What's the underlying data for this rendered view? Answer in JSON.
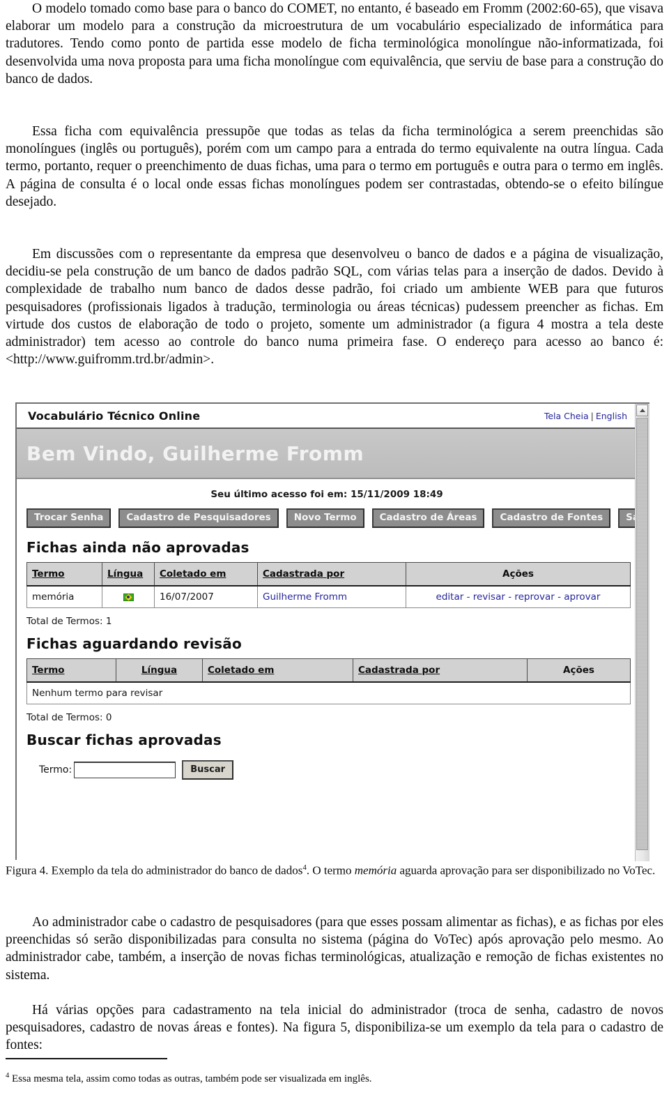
{
  "document": {
    "paragraphs": [
      "O modelo tomado como base para o banco do COMET, no entanto, é baseado em Fromm (2002:60-65), que visava elaborar um modelo para a construção da microestrutura de um vocabulário especializado de informática para tradutores. Tendo como ponto de partida esse modelo de ficha terminológica monolíngue não-informatizada, foi desenvolvida uma nova proposta para uma ficha monolíngue com equivalência, que serviu de base para a construção do banco de dados.",
      "Essa ficha com equivalência pressupõe que todas as telas da ficha terminológica a serem preenchidas são monolíngues (inglês ou português), porém com um campo para a entrada do termo equivalente na outra língua. Cada termo, portanto, requer o preenchimento de duas fichas, uma para o termo em português e outra para o termo em inglês. A página de consulta é o local onde essas fichas monolíngues podem ser contrastadas, obtendo-se o efeito bilíngue desejado.",
      "Em discussões com o representante da empresa que desenvolveu o banco de dados e a página de visualização, decidiu-se pela construção de um banco de dados padrão SQL, com várias telas para a inserção de dados. Devido à complexidade de trabalho num banco de dados desse padrão, foi criado um ambiente WEB para que futuros pesquisadores (profissionais ligados à tradução, terminologia ou áreas técnicas) pudessem preencher as fichas. Em virtude dos custos de elaboração de todo o projeto, somente um administrador (a figura 4 mostra a tela deste administrador) tem acesso ao controle do banco numa primeira fase. O endereço para acesso ao banco é: <http://www.guifromm.trd.br/admin>."
    ],
    "caption": {
      "prefix": "Figura 4. Exemplo da tela do administrador do banco de dados",
      "footnote_marker": "4",
      "middle": ". O termo ",
      "italic_term": "memória",
      "suffix": " aguarda aprovação para ser disponibilizado no VoTec."
    },
    "tail_paragraphs": [
      "Ao administrador cabe o cadastro de pesquisadores (para que esses possam alimentar as fichas), e as fichas por eles preenchidas só serão disponibilizadas para consulta no sistema (página do VoTec) após aprovação pelo mesmo. Ao administrador cabe, também, a inserção de novas fichas terminológicas, atualização e remoção de fichas existentes no sistema.",
      "Há várias opções para cadastramento na tela inicial do administrador (troca de senha, cadastro de novos pesquisadores, cadastro de novas áreas e fontes). Na figura 5, disponibiliza-se um exemplo da tela para o cadastro de fontes:"
    ],
    "footnote": {
      "marker": "4",
      "text": " Essa mesma tela, assim como todas as outras, também pode ser visualizada em inglês."
    }
  },
  "figure": {
    "app": {
      "title": "Vocabulário Técnico Online",
      "links": {
        "fullscreen": "Tela Cheia",
        "separator": "|",
        "english": "English"
      },
      "welcome": "Bem Vindo, Guilherme Fromm",
      "last_access": "Seu último acesso foi em: 15/11/2009 18:49",
      "buttons": [
        "Trocar Senha",
        "Cadastro de Pesquisadores",
        "Novo Termo",
        "Cadastro de Áreas",
        "Cadastro de Fontes",
        "Sair"
      ],
      "section_pending": {
        "heading": "Fichas ainda não aprovadas",
        "columns": [
          "Termo",
          "Língua",
          "Coletado em",
          "Cadastrada por",
          "Ações"
        ],
        "rows": [
          {
            "termo": "memória",
            "lingua_icon": "brazil-flag-icon",
            "coletado_em": "16/07/2007",
            "cadastrada_por": "Guilherme Fromm",
            "acoes": [
              "editar",
              "revisar",
              "reprovar",
              "aprovar"
            ],
            "acoes_text": "editar - revisar - reprovar - aprovar"
          }
        ],
        "total": "Total de Termos: 1"
      },
      "section_review": {
        "heading": "Fichas aguardando revisão",
        "columns": [
          "Termo",
          "Língua",
          "Coletado em",
          "Cadastrada por",
          "Ações"
        ],
        "empty_message": "Nenhum termo para revisar",
        "total": "Total de Termos: 0"
      },
      "section_search": {
        "heading": "Buscar fichas aprovadas",
        "label": "Termo:",
        "input_value": "",
        "input_placeholder": "",
        "button": "Buscar"
      }
    },
    "scrollbar": {
      "up_arrow": "scroll-up-icon"
    }
  },
  "colors": {
    "link": "#26269c",
    "banner_bg": "#c4c4c4",
    "button_bg": "#8d8d8d",
    "table_header_bg": "#d2d2d2",
    "flag_green": "#3aa821",
    "flag_yellow": "#f2d014",
    "flag_blue": "#1b2f8a"
  }
}
